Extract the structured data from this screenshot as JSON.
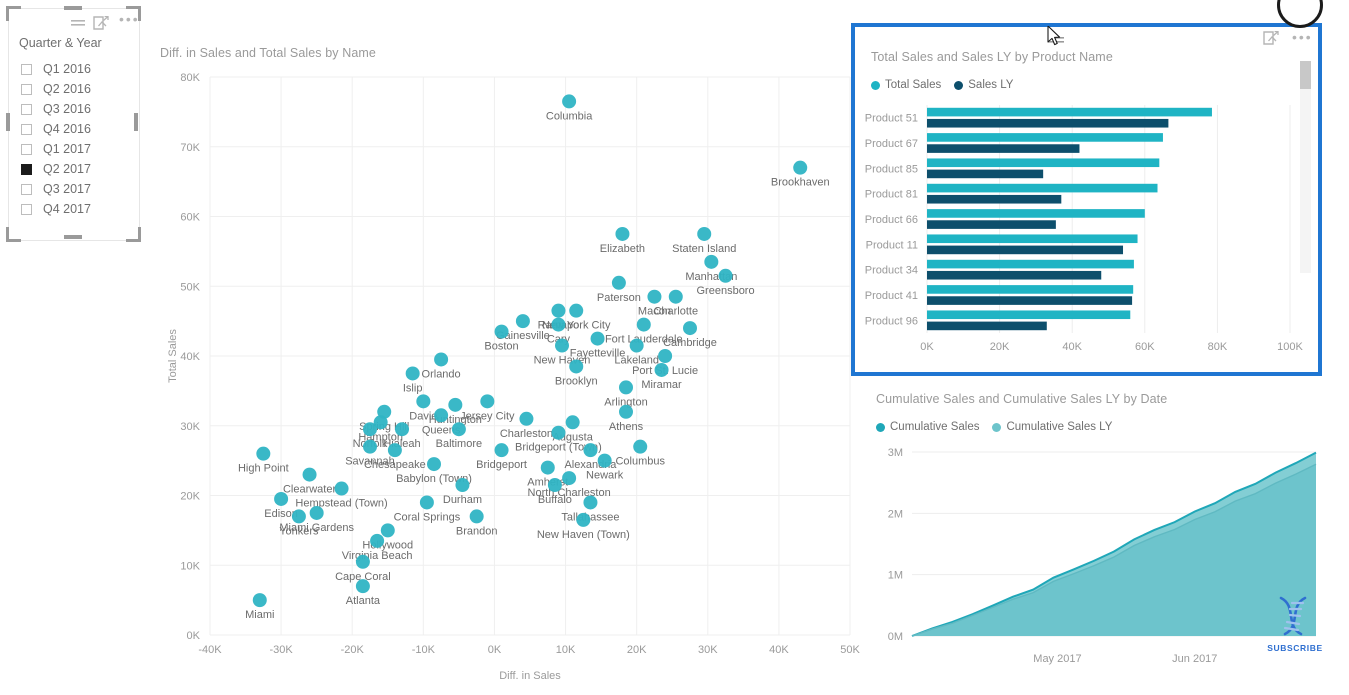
{
  "slicer": {
    "title": "Quarter & Year",
    "header_icons": [
      "list-icon",
      "focus-mode-icon",
      "more-options-icon"
    ],
    "items": [
      {
        "label": "Q1 2016",
        "checked": false
      },
      {
        "label": "Q2 2016",
        "checked": false
      },
      {
        "label": "Q3 2016",
        "checked": false
      },
      {
        "label": "Q4 2016",
        "checked": false
      },
      {
        "label": "Q1 2017",
        "checked": false
      },
      {
        "label": "Q2 2017",
        "checked": true
      },
      {
        "label": "Q3 2017",
        "checked": false
      },
      {
        "label": "Q4 2017",
        "checked": false
      }
    ]
  },
  "scatter": {
    "title": "Diff. in Sales and Total Sales by Name",
    "xlabel": "Diff. in Sales",
    "ylabel": "Total Sales"
  },
  "bar": {
    "title": "Total Sales and Sales LY by Product Name",
    "header_icons": [
      "focus-mode-icon",
      "more-options-icon"
    ]
  },
  "area": {
    "title": "Cumulative Sales and Cumulative Sales LY by Date"
  },
  "watermark": {
    "label": "SUBSCRIBE",
    "icon": "dna-helix-icon"
  },
  "colors": {
    "teal": "#1fb4c4",
    "teal_light": "#63c2c9",
    "navy": "#0d4f6c",
    "selection_blue": "#1f76d2",
    "text_grey": "#6f6f6f",
    "axis_grey": "#9a9a9a",
    "grid": "#eeeeee"
  },
  "chart_data": [
    {
      "type": "scatter",
      "title": "Diff. in Sales and Total Sales by Name",
      "xlabel": "Diff. in Sales",
      "ylabel": "Total Sales",
      "xlim": [
        -40000,
        50000
      ],
      "ylim": [
        0,
        80000
      ],
      "xticks": [
        "-40K",
        "-30K",
        "-20K",
        "-10K",
        "0K",
        "10K",
        "20K",
        "30K",
        "40K",
        "50K"
      ],
      "yticks": [
        "0K",
        "10K",
        "20K",
        "30K",
        "40K",
        "50K",
        "60K",
        "70K",
        "80K"
      ],
      "grid": true,
      "marker_color": "#2fb4c4",
      "points": [
        {
          "name": "Columbia",
          "x": 10500,
          "y": 76500
        },
        {
          "name": "Brookhaven",
          "x": 43000,
          "y": 67000
        },
        {
          "name": "Staten Island",
          "x": 29500,
          "y": 57500
        },
        {
          "name": "Elizabeth",
          "x": 18000,
          "y": 57500
        },
        {
          "name": "Manhattan",
          "x": 30500,
          "y": 53500
        },
        {
          "name": "Greensboro",
          "x": 32500,
          "y": 51500
        },
        {
          "name": "Paterson",
          "x": 17500,
          "y": 50500
        },
        {
          "name": "Macon",
          "x": 22500,
          "y": 48500
        },
        {
          "name": "Charlotte",
          "x": 25500,
          "y": 48500
        },
        {
          "name": "Ramapo",
          "x": 9000,
          "y": 46500
        },
        {
          "name": "New York City",
          "x": 11500,
          "y": 46500
        },
        {
          "name": "Cary",
          "x": 9000,
          "y": 44500
        },
        {
          "name": "Gainesville",
          "x": 4000,
          "y": 45000
        },
        {
          "name": "Fort Lauderdale",
          "x": 21000,
          "y": 44500
        },
        {
          "name": "Cambridge",
          "x": 27500,
          "y": 44000
        },
        {
          "name": "Boston",
          "x": 1000,
          "y": 43500
        },
        {
          "name": "Fayetteville",
          "x": 14500,
          "y": 42500
        },
        {
          "name": "New Haven",
          "x": 9500,
          "y": 41500
        },
        {
          "name": "Lakeland",
          "x": 20000,
          "y": 41500
        },
        {
          "name": "Port St. Lucie",
          "x": 24000,
          "y": 40000
        },
        {
          "name": "Orlando",
          "x": -7500,
          "y": 39500
        },
        {
          "name": "Brooklyn",
          "x": 11500,
          "y": 38500
        },
        {
          "name": "Miramar",
          "x": 23500,
          "y": 38000
        },
        {
          "name": "Arlington",
          "x": 18500,
          "y": 35500
        },
        {
          "name": "Islip",
          "x": -11500,
          "y": 37500
        },
        {
          "name": "Davie",
          "x": -10000,
          "y": 33500
        },
        {
          "name": "Huntington",
          "x": -5500,
          "y": 33000
        },
        {
          "name": "Jersey City",
          "x": -1000,
          "y": 33500
        },
        {
          "name": "Spring Hill",
          "x": -15500,
          "y": 32000
        },
        {
          "name": "Athens",
          "x": 18500,
          "y": 32000
        },
        {
          "name": "Hampton",
          "x": -16000,
          "y": 30500
        },
        {
          "name": "Queens",
          "x": -7500,
          "y": 31500
        },
        {
          "name": "Charleston",
          "x": 4500,
          "y": 31000
        },
        {
          "name": "Augusta",
          "x": 11000,
          "y": 30500
        },
        {
          "name": "Baltimore",
          "x": -5000,
          "y": 29500
        },
        {
          "name": "Bridgeport (Town)",
          "x": 9000,
          "y": 29000
        },
        {
          "name": "Norfolk",
          "x": -17500,
          "y": 29500
        },
        {
          "name": "Hialeah",
          "x": -13000,
          "y": 29500
        },
        {
          "name": "Columbus",
          "x": 20500,
          "y": 27000
        },
        {
          "name": "Savannah",
          "x": -17500,
          "y": 27000
        },
        {
          "name": "Chesapeake",
          "x": -14000,
          "y": 26500
        },
        {
          "name": "Bridgeport",
          "x": 1000,
          "y": 26500
        },
        {
          "name": "Alexandria",
          "x": 13500,
          "y": 26500
        },
        {
          "name": "High Point",
          "x": -32500,
          "y": 26000
        },
        {
          "name": "Babylon (Town)",
          "x": -8500,
          "y": 24500
        },
        {
          "name": "Amherst",
          "x": 7500,
          "y": 24000
        },
        {
          "name": "Newark",
          "x": 15500,
          "y": 25000
        },
        {
          "name": "Clearwater",
          "x": -26000,
          "y": 23000
        },
        {
          "name": "North Charleston",
          "x": 10500,
          "y": 22500
        },
        {
          "name": "Durham",
          "x": -4500,
          "y": 21500
        },
        {
          "name": "Buffalo",
          "x": 8500,
          "y": 21500
        },
        {
          "name": "Hempstead (Town)",
          "x": -21500,
          "y": 21000
        },
        {
          "name": "Edison",
          "x": -30000,
          "y": 19500
        },
        {
          "name": "Coral Springs",
          "x": -9500,
          "y": 19000
        },
        {
          "name": "Tallahassee",
          "x": 13500,
          "y": 19000
        },
        {
          "name": "Miami Gardens",
          "x": -25000,
          "y": 17500
        },
        {
          "name": "Yonkers",
          "x": -27500,
          "y": 17000
        },
        {
          "name": "Brandon",
          "x": -2500,
          "y": 17000
        },
        {
          "name": "New Haven (Town)",
          "x": 12500,
          "y": 16500
        },
        {
          "name": "Hollywood",
          "x": -15000,
          "y": 15000
        },
        {
          "name": "Virginia Beach",
          "x": -16500,
          "y": 13500
        },
        {
          "name": "Cape Coral",
          "x": -18500,
          "y": 10500
        },
        {
          "name": "Atlanta",
          "x": -18500,
          "y": 7000
        },
        {
          "name": "Miami",
          "x": -33000,
          "y": 5000
        }
      ]
    },
    {
      "type": "bar",
      "orientation": "horizontal",
      "title": "Total Sales and Sales LY by Product Name",
      "categories": [
        "Product 51",
        "Product 67",
        "Product 85",
        "Product 81",
        "Product 66",
        "Product 11",
        "Product 34",
        "Product 41",
        "Product 96"
      ],
      "series": [
        {
          "name": "Total Sales",
          "color": "#1fb4c4",
          "values": [
            78500,
            65000,
            64000,
            63500,
            60000,
            58000,
            57000,
            56800,
            56000
          ]
        },
        {
          "name": "Sales LY",
          "color": "#0d4f6c",
          "values": [
            66500,
            42000,
            32000,
            37000,
            35500,
            54000,
            48000,
            56500,
            33000
          ]
        }
      ],
      "xticks": [
        "0K",
        "20K",
        "40K",
        "60K",
        "80K",
        "100K"
      ],
      "xlim": [
        0,
        100000
      ],
      "legend_position": "top",
      "scrollbar": true
    },
    {
      "type": "area",
      "title": "Cumulative Sales and Cumulative Sales LY by Date",
      "xlabel": "",
      "ylabel": "",
      "xticks": [
        "May 2017",
        "Jun 2017"
      ],
      "yticks": [
        "0M",
        "1M",
        "2M",
        "3M"
      ],
      "ylim": [
        0,
        3000000
      ],
      "legend_position": "top",
      "series": [
        {
          "name": "Cumulative Sales",
          "color": "#1fa7b8",
          "values": [
            0,
            120000,
            250000,
            370000,
            500000,
            640000,
            780000,
            930000,
            1080000,
            1230000,
            1390000,
            1560000,
            1720000,
            1880000,
            2030000,
            2180000,
            2340000,
            2500000,
            2660000,
            2820000,
            2990000
          ]
        },
        {
          "name": "Cumulative Sales LY",
          "color": "#6dc4cb",
          "values": [
            0,
            110000,
            230000,
            350000,
            470000,
            600000,
            730000,
            870000,
            1010000,
            1150000,
            1300000,
            1460000,
            1610000,
            1760000,
            1900000,
            2040000,
            2190000,
            2340000,
            2490000,
            2640000,
            2800000
          ]
        }
      ]
    }
  ]
}
